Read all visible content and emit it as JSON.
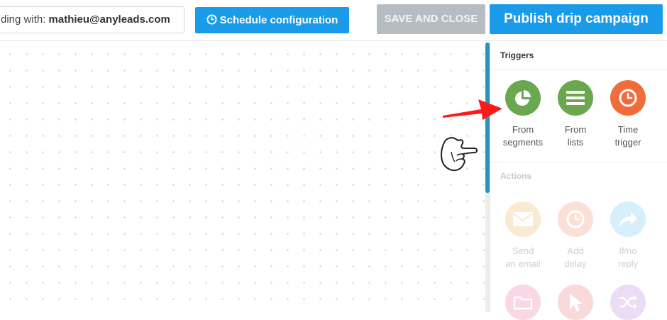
{
  "topbar": {
    "sender_prefix": "ding with: ",
    "sender_email": "mathieu@anyleads.com",
    "schedule_label": "Schedule configuration",
    "save_label": "SAVE AND CLOSE",
    "publish_label": "Publish drip campaign"
  },
  "panel": {
    "triggers_title": "Triggers",
    "actions_title": "Actions",
    "triggers": [
      {
        "line1": "From",
        "line2": "segments",
        "icon": "pie-chart-icon",
        "color": "#6aa84f"
      },
      {
        "line1": "From",
        "line2": "lists",
        "icon": "list-icon",
        "color": "#6aa84f"
      },
      {
        "line1": "Time",
        "line2": "trigger",
        "icon": "clock-icon",
        "color": "#f26b3a"
      }
    ],
    "actions": [
      {
        "line1": "Send",
        "line2": "an email",
        "icon": "envelope-icon",
        "color": "#f5c179"
      },
      {
        "line1": "Add",
        "line2": "delay",
        "icon": "clock-icon",
        "color": "#f2a487"
      },
      {
        "line1": "If/no",
        "line2": "reply",
        "icon": "share-arrow-icon",
        "color": "#84cff0"
      },
      {
        "line1": "",
        "line2": "",
        "icon": "folder-icon",
        "color": "#ee89b0"
      },
      {
        "line1": "",
        "line2": "",
        "icon": "cursor-icon",
        "color": "#ef8f8f"
      },
      {
        "line1": "",
        "line2": "",
        "icon": "shuffle-icon",
        "color": "#c79be0"
      }
    ]
  }
}
